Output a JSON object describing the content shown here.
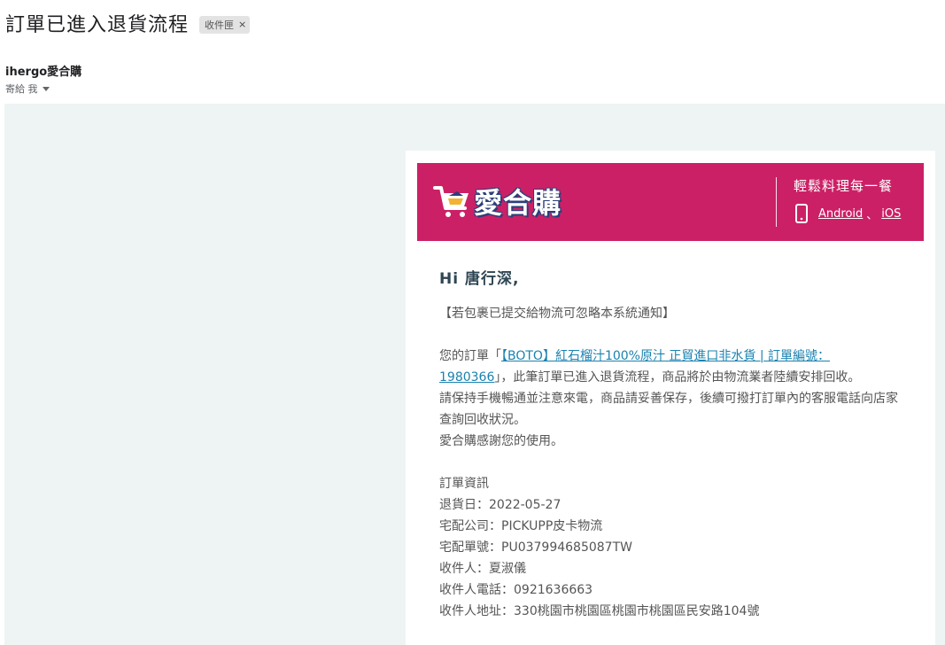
{
  "email": {
    "subject": "訂單已進入退貨流程",
    "label": "收件匣",
    "label_remove": "×",
    "sender": "ihergo愛合購",
    "to_text": "寄給 我"
  },
  "banner": {
    "logo_text": "愛合購",
    "tagline": "輕鬆料理每一餐",
    "android": "Android",
    "separator": "、",
    "ios": "iOS",
    "background_color": "#cc2066"
  },
  "body": {
    "greeting": "Hi 唐行深,",
    "notice": "【若包裹已提交給物流可忽略本系統通知】",
    "order_prefix": "您的訂單「",
    "order_link": "【BOTO】紅石榴汁100%原汁 正貿進口非水貨 | 訂單編號：1980366",
    "order_suffix": "」，此筆訂單已進入退貨流程，商品將於由物流業者陸續安排回收。",
    "line2": "請保持手機暢通並注意來電，商品請妥善保存，後續可撥打訂單內的客服電話向店家查詢回收狀況。",
    "thanks": "愛合購感謝您的使用。"
  },
  "order_info": {
    "heading": "訂單資訊",
    "return_date": "退貨日：2022-05-27",
    "courier": "宅配公司：PICKUPP皮卡物流",
    "tracking": "宅配單號：PU037994685087TW",
    "recipient": "收件人：夏淑儀",
    "phone": "收件人電話：0921636663",
    "address": "收件人地址：330桃園市桃園區桃園市桃園區民安路104號"
  }
}
